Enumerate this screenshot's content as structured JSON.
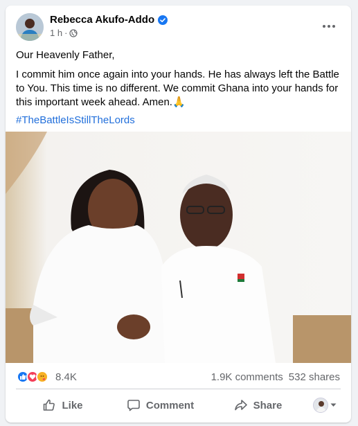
{
  "post": {
    "author": "Rebecca Akufo-Addo",
    "time": "1 h",
    "paragraphs": [
      "Our Heavenly Father,",
      "I commit him once again into your hands. He has always left the Battle to You. This time is no different. We commit Ghana into your hands for this important week ahead. Amen.🙏"
    ],
    "hashtag": "#TheBattleIsStillTheLords"
  },
  "stats": {
    "reactions": "8.4K",
    "comments": "1.9K comments",
    "shares": "532 shares"
  },
  "actions": {
    "like": "Like",
    "comment": "Comment",
    "share": "Share"
  },
  "colors": {
    "accent": "#1877f2",
    "hashtag": "#216fdb",
    "muted": "#65676b"
  },
  "icons": [
    "verified-badge-icon",
    "globe-icon",
    "more-options-icon",
    "like-reaction-icon",
    "love-reaction-icon",
    "care-reaction-icon",
    "thumbs-up-icon",
    "comment-bubble-icon",
    "share-arrow-icon",
    "chevron-down-icon"
  ]
}
